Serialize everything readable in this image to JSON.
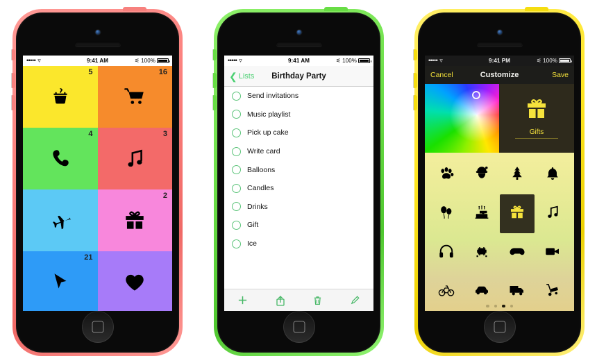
{
  "phones": [
    {
      "name": "lists-grid-phone",
      "case_color": "#f06a67",
      "case_name": "pink",
      "status": {
        "signal": "•••••",
        "wifi": "wifi-icon",
        "time": "9:41 AM",
        "bluetooth": "bluetooth-icon",
        "battery": "100%"
      },
      "app": "category-grid",
      "tiles": [
        {
          "label": "cooking",
          "icon": "pot-icon",
          "glyph": "🍲",
          "count": "5",
          "color": "#fbe72c"
        },
        {
          "label": "shopping",
          "icon": "cart-icon",
          "glyph": "🛒",
          "count": "16",
          "color": "#f68b2c"
        },
        {
          "label": "calls",
          "icon": "phone-icon",
          "glyph": "📞",
          "count": "4",
          "color": "#63e45c"
        },
        {
          "label": "music",
          "icon": "music-icon",
          "glyph": "♫",
          "count": "3",
          "color": "#f36a69"
        },
        {
          "label": "travel",
          "icon": "airplane-icon",
          "glyph": "✈",
          "count": "",
          "color": "#5cc9f5"
        },
        {
          "label": "gifts",
          "icon": "gift-icon",
          "glyph": "🎁",
          "count": "2",
          "color": "#f887dc"
        },
        {
          "label": "work",
          "icon": "cursor-icon",
          "glyph": "➤",
          "count": "21",
          "color": "#2e9bf7"
        },
        {
          "label": "hearts",
          "icon": "heart-icon",
          "glyph": "♥",
          "count": "",
          "color": "#a77bf9"
        }
      ]
    },
    {
      "name": "checklist-phone",
      "case_color": "#4fc72f",
      "case_name": "green",
      "status": {
        "signal": "•••••",
        "wifi": "wifi-icon",
        "time": "9:41 AM",
        "bluetooth": "bluetooth-icon",
        "battery": "100%"
      },
      "app": "checklist",
      "nav": {
        "back_label": "Lists",
        "title": "Birthday Party"
      },
      "items": [
        "Send invitations",
        "Music playlist",
        "Pick up cake",
        "Write card",
        "Balloons",
        "Candles",
        "Drinks",
        "Gift",
        "Ice"
      ],
      "toolbar": [
        {
          "name": "add-button",
          "icon": "plus-icon"
        },
        {
          "name": "share-button",
          "icon": "share-icon"
        },
        {
          "name": "delete-button",
          "icon": "trash-icon"
        },
        {
          "name": "edit-button",
          "icon": "pencil-icon"
        }
      ]
    },
    {
      "name": "customize-phone",
      "case_color": "#ecd000",
      "case_name": "yellow",
      "status": {
        "signal": "•••••",
        "wifi": "wifi-icon",
        "time": "9:41 PM",
        "bluetooth": "bluetooth-icon",
        "battery": "100%"
      },
      "app": "customize",
      "nav": {
        "cancel_label": "Cancel",
        "title": "Customize",
        "save_label": "Save"
      },
      "preview": {
        "icon": "gift-icon",
        "glyph": "🎁",
        "label": "Gifts",
        "accent": "#f5e23c"
      },
      "color_picker": {
        "name": "color-wheel",
        "selected_hint": "yellow"
      },
      "icons": [
        {
          "name": "paw-icon",
          "glyph": "🐾",
          "selected": false
        },
        {
          "name": "santa-icon",
          "glyph": "🎅",
          "selected": false
        },
        {
          "name": "christmas-tree-icon",
          "glyph": "🎄",
          "selected": false
        },
        {
          "name": "bell-icon",
          "glyph": "🔔",
          "selected": false
        },
        {
          "name": "balloons-icon",
          "glyph": "🎈",
          "selected": false
        },
        {
          "name": "birthday-cake-icon",
          "glyph": "🎂",
          "selected": false
        },
        {
          "name": "gift-icon",
          "glyph": "🎁",
          "selected": true
        },
        {
          "name": "music-note-icon",
          "glyph": "♫",
          "selected": false
        },
        {
          "name": "headphones-icon",
          "glyph": "🎧",
          "selected": false
        },
        {
          "name": "space-invader-icon",
          "glyph": "👾",
          "selected": false
        },
        {
          "name": "gamepad-icon",
          "glyph": "🎮",
          "selected": false
        },
        {
          "name": "video-camera-icon",
          "glyph": "📹",
          "selected": false
        },
        {
          "name": "bicycle-icon",
          "glyph": "🚲",
          "selected": false
        },
        {
          "name": "car-icon",
          "glyph": "🚗",
          "selected": false
        },
        {
          "name": "truck-icon",
          "glyph": "🚚",
          "selected": false
        },
        {
          "name": "hand-truck-icon",
          "glyph": "🛒",
          "selected": false
        }
      ],
      "pages": {
        "count": 4,
        "active": 3
      }
    }
  ]
}
